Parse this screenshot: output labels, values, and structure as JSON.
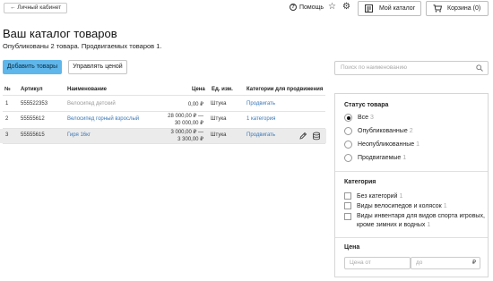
{
  "topbar": {
    "back_label": "← Личный кабинет",
    "help_label": "Помощь",
    "catalog_label": "Мой каталог",
    "cart_label": "Корзина (0)"
  },
  "page": {
    "title": "Ваш каталог товаров",
    "subtitle": "Опубликованы 2 товара. Продвигаемых товаров 1."
  },
  "actions": {
    "add_label": "Добавить товары",
    "price_label": "Управлять ценой"
  },
  "table": {
    "headers": {
      "num": "№",
      "article": "Артикул",
      "name": "Наименование",
      "price": "Цена",
      "unit": "Ед. изм.",
      "categories": "Категории для продвижения"
    },
    "rows": [
      {
        "num": "1",
        "article": "555522353",
        "name": "Велосипед детский",
        "price": "0,00 ₽",
        "price2": "",
        "unit": "Штука",
        "category": "Продвигать"
      },
      {
        "num": "2",
        "article": "55555612",
        "name": "Велосипед горный взрослый",
        "price": "28 000,00 ₽ —",
        "price2": "30 000,00 ₽",
        "unit": "Штука",
        "category": "1 категория"
      },
      {
        "num": "3",
        "article": "55555615",
        "name": "Гиря 16кг",
        "price": "3 000,00 ₽ —",
        "price2": "3 300,00 ₽",
        "unit": "Штука",
        "category": "Продвигать"
      }
    ]
  },
  "search": {
    "placeholder": "Поиск по наименованию"
  },
  "filters": {
    "status_title": "Статус товара",
    "status": [
      {
        "label": "Все",
        "count": "3"
      },
      {
        "label": "Опубликованные",
        "count": "2"
      },
      {
        "label": "Неопубликованные",
        "count": "1"
      },
      {
        "label": "Продвигаемые",
        "count": "1"
      }
    ],
    "category_title": "Категория",
    "categories": [
      {
        "label": "Без категорий",
        "count": "1"
      },
      {
        "label": "Виды велосипедов и колясок",
        "count": "1"
      },
      {
        "label": "Виды инвентаря для видов спорта игровых,",
        "label2": "кроме зимних и водных",
        "count": "1"
      }
    ],
    "price_title": "Цена",
    "price_from": "Цена от",
    "price_to": "до",
    "currency": "₽"
  },
  "colors": {
    "accent": "#5fb6ea",
    "link": "#3b78b7",
    "row_highlight": "#ebebeb"
  }
}
